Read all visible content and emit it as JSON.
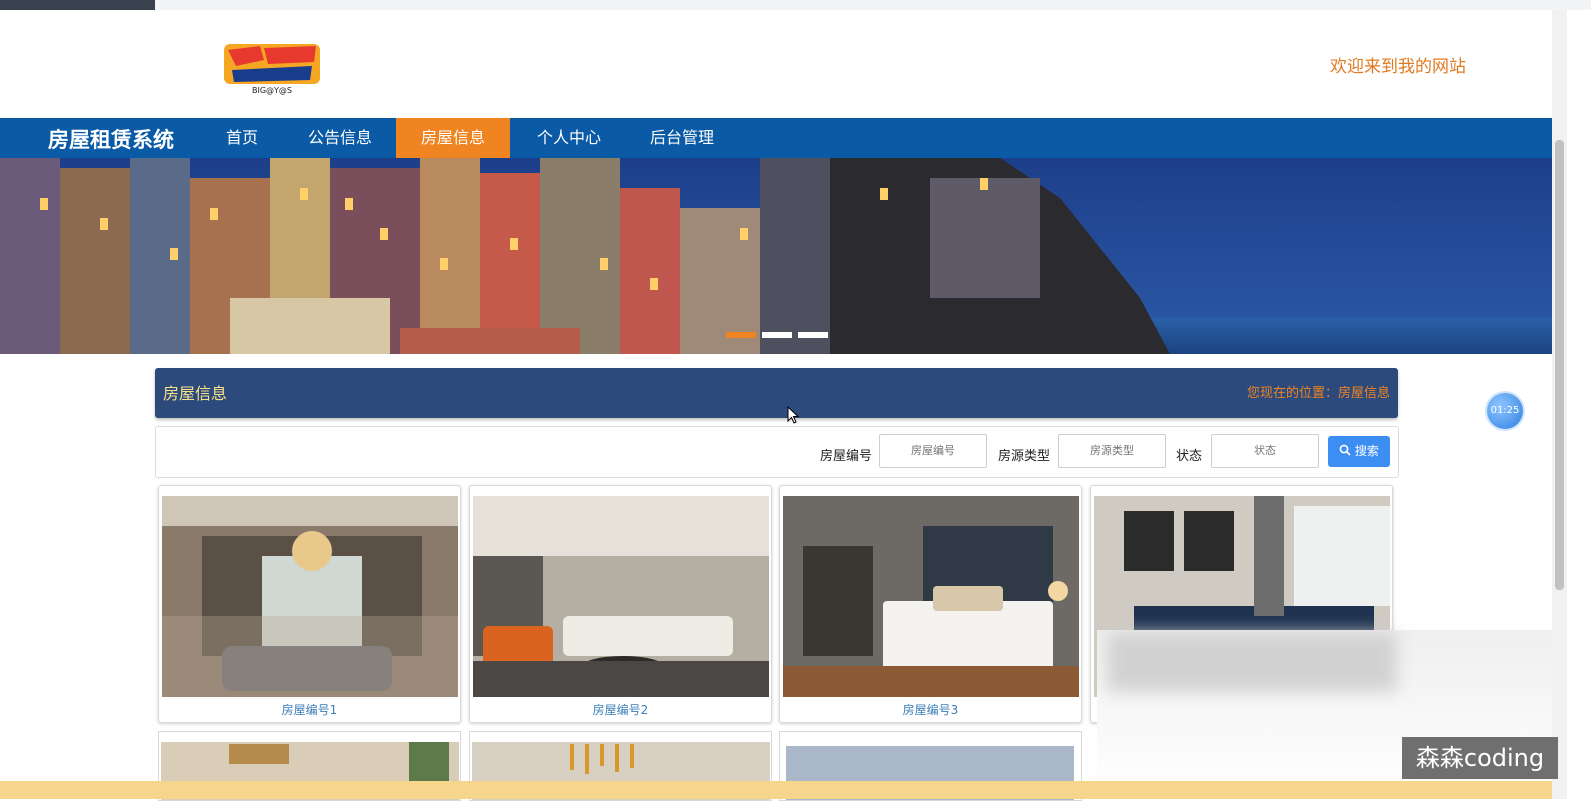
{
  "header": {
    "logo_text": "BIG@Y@S",
    "welcome_text": "欢迎来到我的网站"
  },
  "nav": {
    "brand": "房屋租赁系统",
    "items": [
      {
        "label": "首页",
        "active": false
      },
      {
        "label": "公告信息",
        "active": false
      },
      {
        "label": "房屋信息",
        "active": true
      },
      {
        "label": "个人中心",
        "active": false
      },
      {
        "label": "后台管理",
        "active": false
      }
    ]
  },
  "banner": {
    "dots": [
      true,
      false,
      false
    ]
  },
  "section": {
    "title": "房屋信息",
    "breadcrumb_prefix": "您现在的位置：",
    "breadcrumb_current": "房屋信息"
  },
  "search": {
    "fields": [
      {
        "label": "房屋编号",
        "placeholder": "房屋编号"
      },
      {
        "label": "房源类型",
        "placeholder": "房源类型"
      },
      {
        "label": "状态",
        "placeholder": "状态"
      }
    ],
    "button_label": "搜索",
    "button_icon": "search-icon"
  },
  "houses": [
    {
      "caption": "房屋编号1"
    },
    {
      "caption": "房屋编号2"
    },
    {
      "caption": "房屋编号3"
    },
    {
      "caption": ""
    }
  ],
  "overlay": {
    "timer": "01:25",
    "watermark": "森森coding"
  },
  "colors": {
    "nav": "#0a5aa6",
    "accent": "#f08420",
    "section": "#2d4a7c",
    "button": "#3c8ef2"
  }
}
